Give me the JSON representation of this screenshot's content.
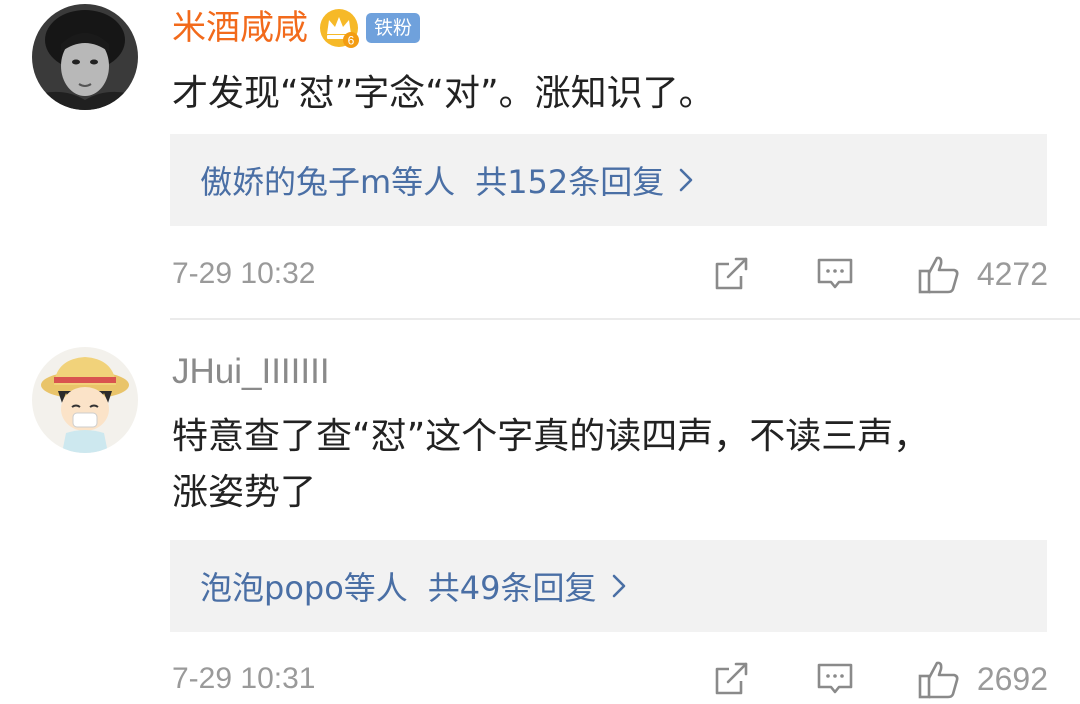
{
  "comments": [
    {
      "username": "米酒咸咸",
      "fan_badge": "铁粉",
      "text": "才发现“怼”字念“对”。涨知识了。",
      "replies": {
        "users": "傲娇的兔子m等人",
        "count": "共152条回复"
      },
      "timestamp": "7-29 10:32",
      "likes": "4272"
    },
    {
      "username": "JHui_IIIIIII",
      "text": "特意查了查“怼”这个字真的读四声，不读三声，\n涨姿势了",
      "replies": {
        "users": "泡泡popo等人",
        "count": "共49条回复"
      },
      "timestamp": "7-29 10:31",
      "likes": "2692"
    }
  ],
  "colors": {
    "vip_username": "#f26a1b",
    "normal_username": "#8a8a8a",
    "link_blue": "#4a6fa5",
    "fan_badge_bg": "#6fa1dc",
    "reply_box_bg": "#f2f2f2",
    "meta_gray": "#9a9a9a"
  },
  "icons": {
    "crown": "crown-vip-icon",
    "repost": "repost-icon",
    "comment": "comment-icon",
    "like": "thumbs-up-icon",
    "chevron": "chevron-right-icon"
  }
}
